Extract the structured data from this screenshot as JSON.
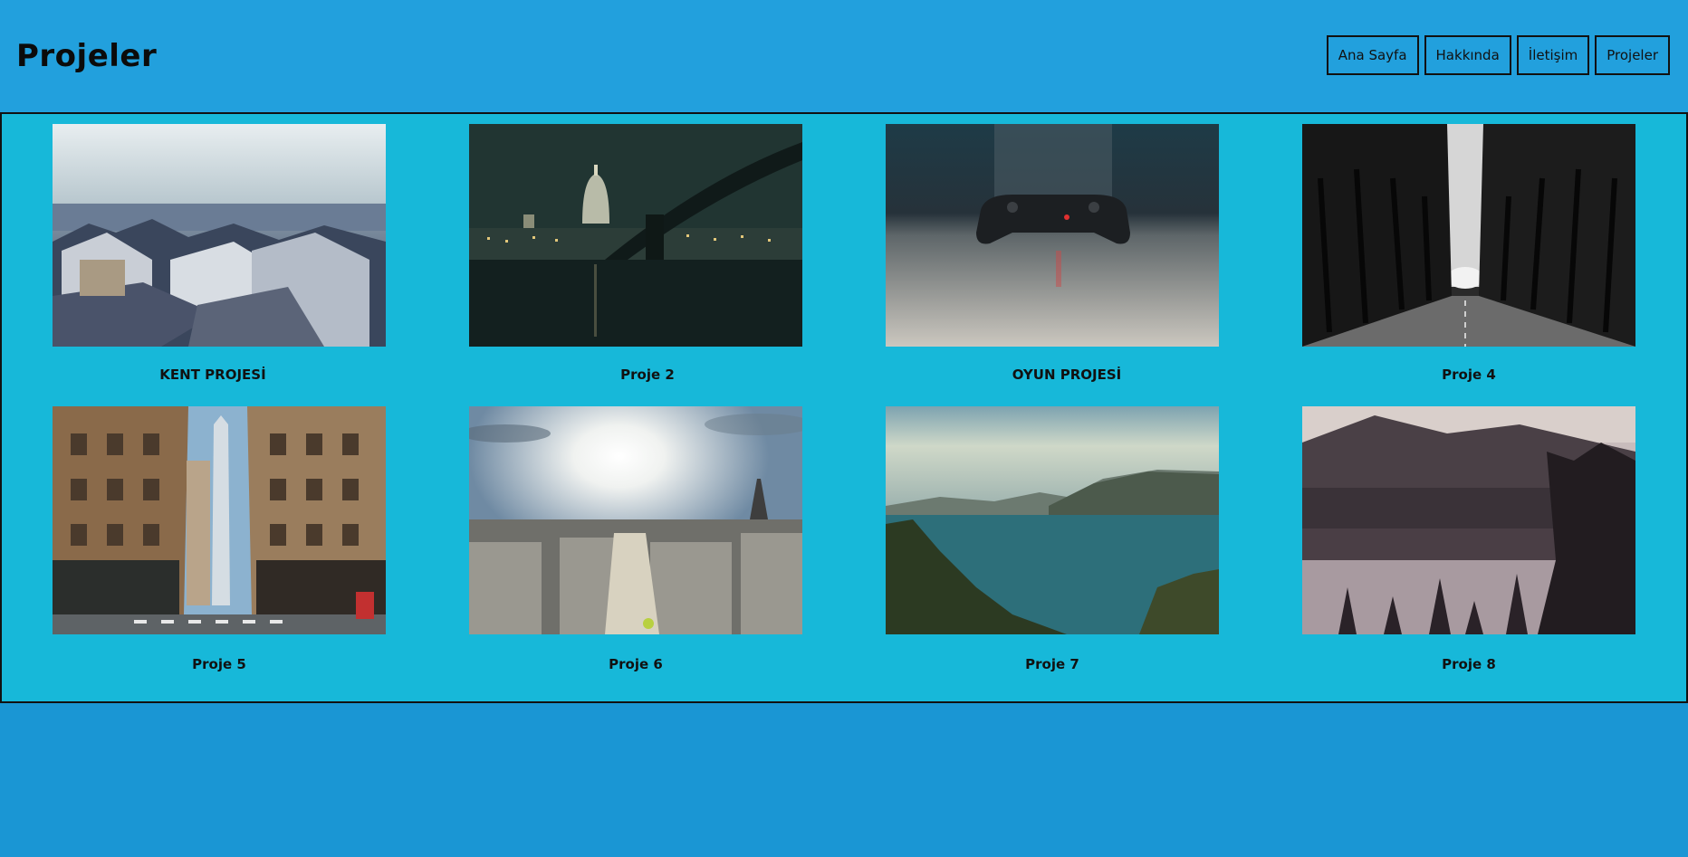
{
  "header": {
    "title": "Projeler"
  },
  "nav": {
    "items": [
      "Ana Sayfa",
      "Hakkında",
      "İletişim",
      "Projeler"
    ]
  },
  "projects": [
    {
      "title": "KENT PROJESİ",
      "image": "city-rooftops-snow-photo"
    },
    {
      "title": "Proje 2",
      "image": "night-city-bridge-photo"
    },
    {
      "title": "OYUN PROJESİ",
      "image": "game-controller-photo"
    },
    {
      "title": "Proje 4",
      "image": "tree-tunnel-road-photo"
    },
    {
      "title": "Proje 5",
      "image": "city-street-skyscraper-photo"
    },
    {
      "title": "Proje 6",
      "image": "paris-sunny-skyline-photo"
    },
    {
      "title": "Proje 7",
      "image": "mountain-lake-photo"
    },
    {
      "title": "Proje 8",
      "image": "forest-lake-reflection-photo"
    }
  ]
}
